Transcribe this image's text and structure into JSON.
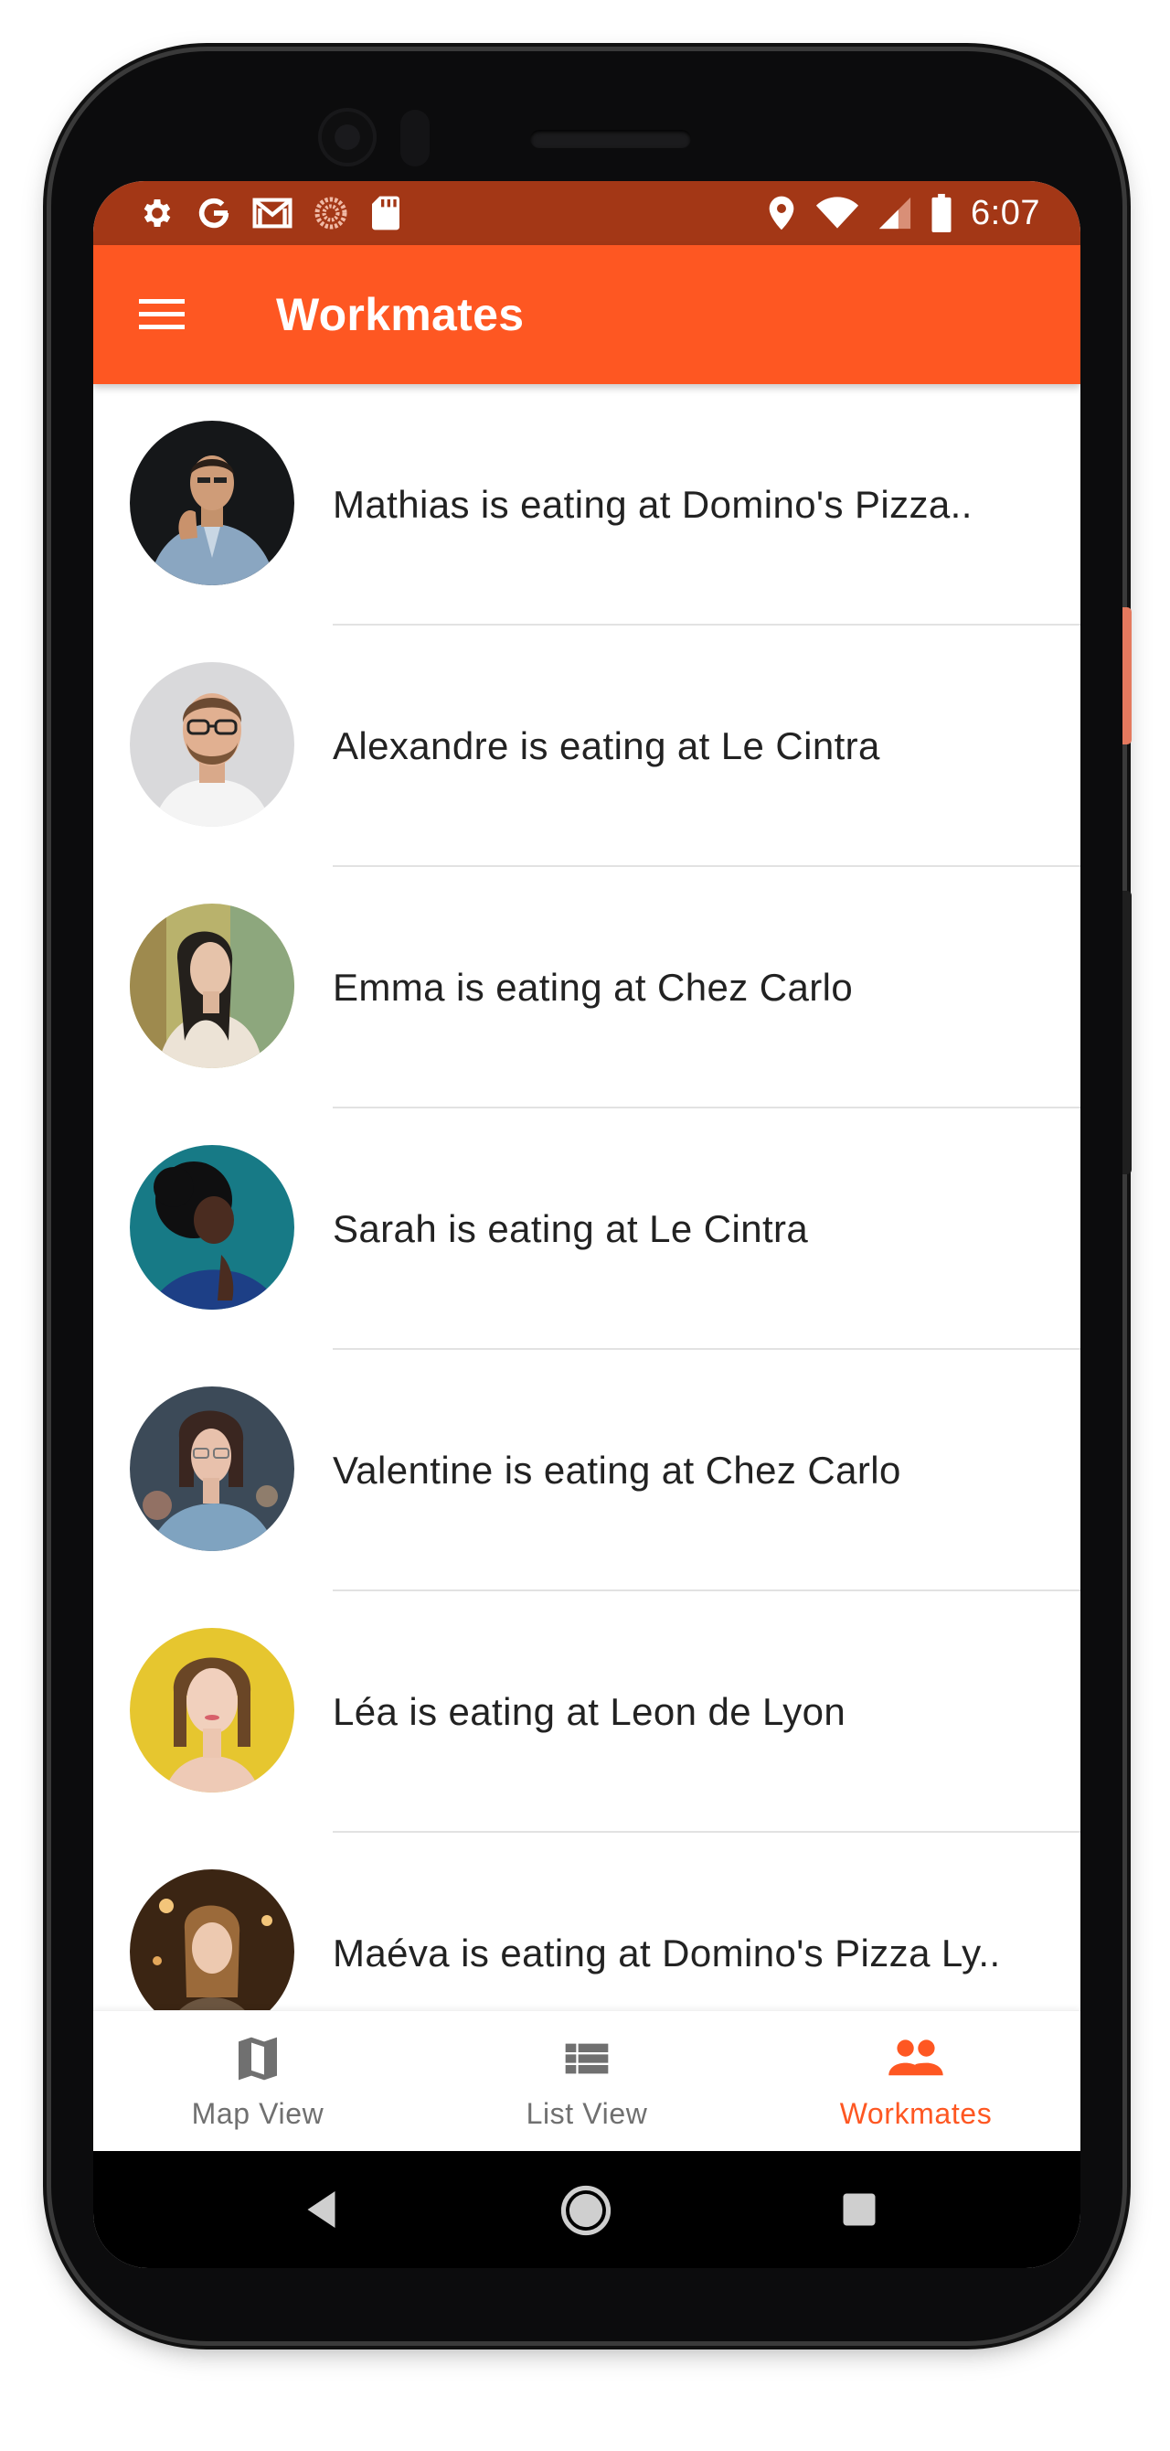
{
  "status_bar": {
    "time": "6:07",
    "left_icons": [
      "settings-icon",
      "google-icon",
      "gmail-icon",
      "sync-circle-icon",
      "sd-card-icon"
    ],
    "right_icons": [
      "location-icon",
      "wifi-icon",
      "signal-icon",
      "battery-icon"
    ]
  },
  "app_bar": {
    "title": "Workmates",
    "menu_icon": "hamburger-menu-icon",
    "color": "#fe5722"
  },
  "workmates": [
    {
      "text": "Mathias is eating at Domino's Pizza..",
      "avatar": "man-dark-background"
    },
    {
      "text": "Alexandre is eating at Le Cintra",
      "avatar": "man-with-glasses"
    },
    {
      "text": "Emma is eating at Chez Carlo",
      "avatar": "woman-long-hair-garden"
    },
    {
      "text": "Sarah is eating at Le Cintra",
      "avatar": "woman-curly-hair-teal"
    },
    {
      "text": "Valentine is eating at Chez Carlo",
      "avatar": "woman-glasses-bob"
    },
    {
      "text": "Léa is eating at Leon de Lyon",
      "avatar": "woman-yellow-background"
    },
    {
      "text": "Maéva is eating at Domino's Pizza Ly..",
      "avatar": "woman-warm-lights"
    }
  ],
  "bottom_nav": [
    {
      "label": "Map View",
      "icon": "map-icon",
      "active": false
    },
    {
      "label": "List View",
      "icon": "list-icon",
      "active": false
    },
    {
      "label": "Workmates",
      "icon": "people-icon",
      "active": true
    }
  ],
  "colors": {
    "accent": "#fe5722",
    "status_bar": "#a33716",
    "inactive_nav": "#707070"
  }
}
